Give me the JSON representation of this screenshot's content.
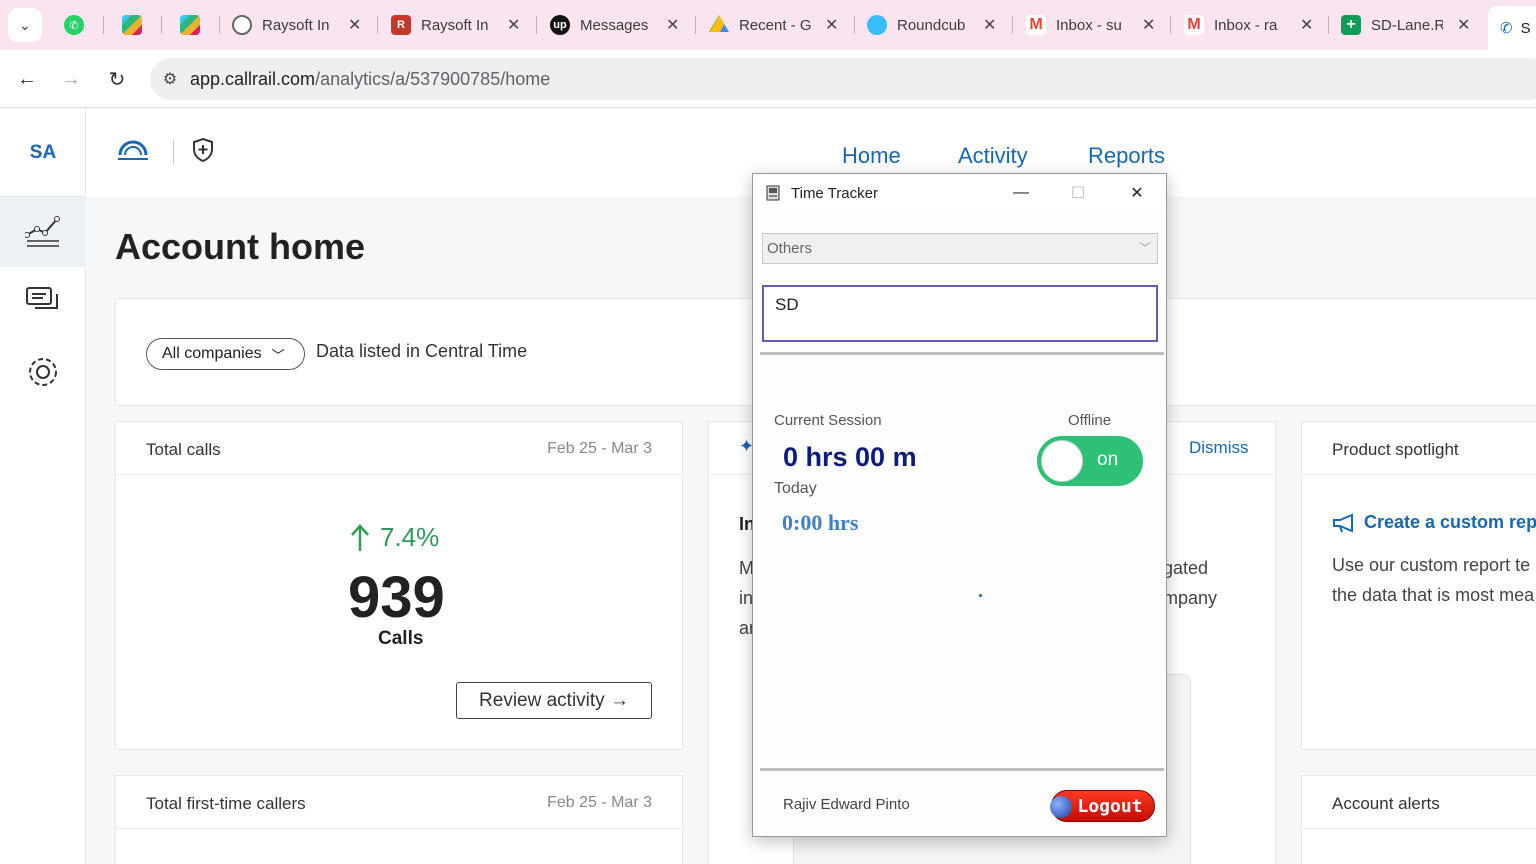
{
  "browser": {
    "tabs": [
      {
        "label": "",
        "icon": "whatsapp-icon"
      },
      {
        "label": "",
        "icon": "slack-icon"
      },
      {
        "label": "",
        "icon": "slack-icon"
      },
      {
        "label": "Raysoft In",
        "icon": "globe-icon"
      },
      {
        "label": "Raysoft In",
        "icon": "raysoft-icon"
      },
      {
        "label": "Messages",
        "icon": "upwork-icon"
      },
      {
        "label": "Recent - G",
        "icon": "drive-icon"
      },
      {
        "label": "Roundcub",
        "icon": "roundcube-icon"
      },
      {
        "label": "Inbox - su",
        "icon": "gmail-icon"
      },
      {
        "label": "Inbox - ra",
        "icon": "gmail-icon"
      },
      {
        "label": "SD-Lane.R",
        "icon": "sheets-icon"
      }
    ],
    "active_tab_label": "S",
    "url_host": "app.callrail.com",
    "url_path": "/analytics/a/537900785/home"
  },
  "app": {
    "account_initials": "SA",
    "nav": {
      "home": "Home",
      "activity": "Activity",
      "reports": "Reports"
    },
    "page_title": "Account home",
    "filter": {
      "companies": "All companies",
      "timezone_note": "Data listed in Central Time"
    },
    "total_calls": {
      "title": "Total calls",
      "date_range": "Feb 25 - Mar 3",
      "change": "7.4%",
      "value": "939",
      "unit": "Calls",
      "review_button": "Review activity →"
    },
    "insight": {
      "dismiss": "Dismiss",
      "frag_title": "In",
      "frag_l1": "M",
      "frag_l2": "in",
      "frag_l3": "ar",
      "frag_r1": "gated",
      "frag_r2": "mpany"
    },
    "spotlight": {
      "title": "Product spotlight",
      "link": "Create a custom repo",
      "text_line1": "Use our custom report te",
      "text_line2": "the data that is most mea"
    },
    "first_time_callers": {
      "title": "Total first-time callers",
      "date_range": "Feb 25 - Mar 3"
    },
    "alerts": {
      "title": "Account alerts"
    }
  },
  "time_tracker": {
    "title": "Time Tracker",
    "category": "Others",
    "task_text": "SD",
    "current_session_label": "Current Session",
    "status_label": "Offline",
    "session_time": "0 hrs 00 m",
    "toggle_label": "on",
    "today_label": "Today",
    "today_time": "0:00 hrs",
    "user_name": "Rajiv Edward Pinto",
    "logout_label": "Logout"
  }
}
